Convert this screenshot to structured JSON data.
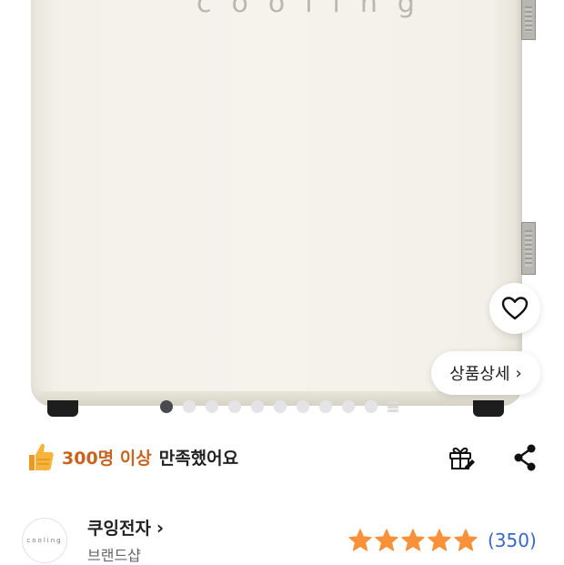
{
  "product_image": {
    "brand_watermark": "cooling",
    "pager": {
      "total": 10,
      "active_index": 0
    }
  },
  "wishlist": {
    "icon": "heart-outline-icon"
  },
  "detail": {
    "label": "상품상세",
    "chevron": "›"
  },
  "satisfaction": {
    "icon": "thumbs-up-icon",
    "count": "300명 이상",
    "text": "만족했어요"
  },
  "actions": {
    "gift_icon": "gift-icon",
    "share_icon": "share-icon"
  },
  "seller": {
    "avatar_text": "cooling",
    "name": "쿠잉전자",
    "chevron": "›",
    "type": "브랜드샵"
  },
  "rating": {
    "stars": 5,
    "review_count": "(350)"
  },
  "colors": {
    "accent_orange": "#c8641e",
    "star": "#f7923a",
    "link_blue": "#3b66c9"
  }
}
